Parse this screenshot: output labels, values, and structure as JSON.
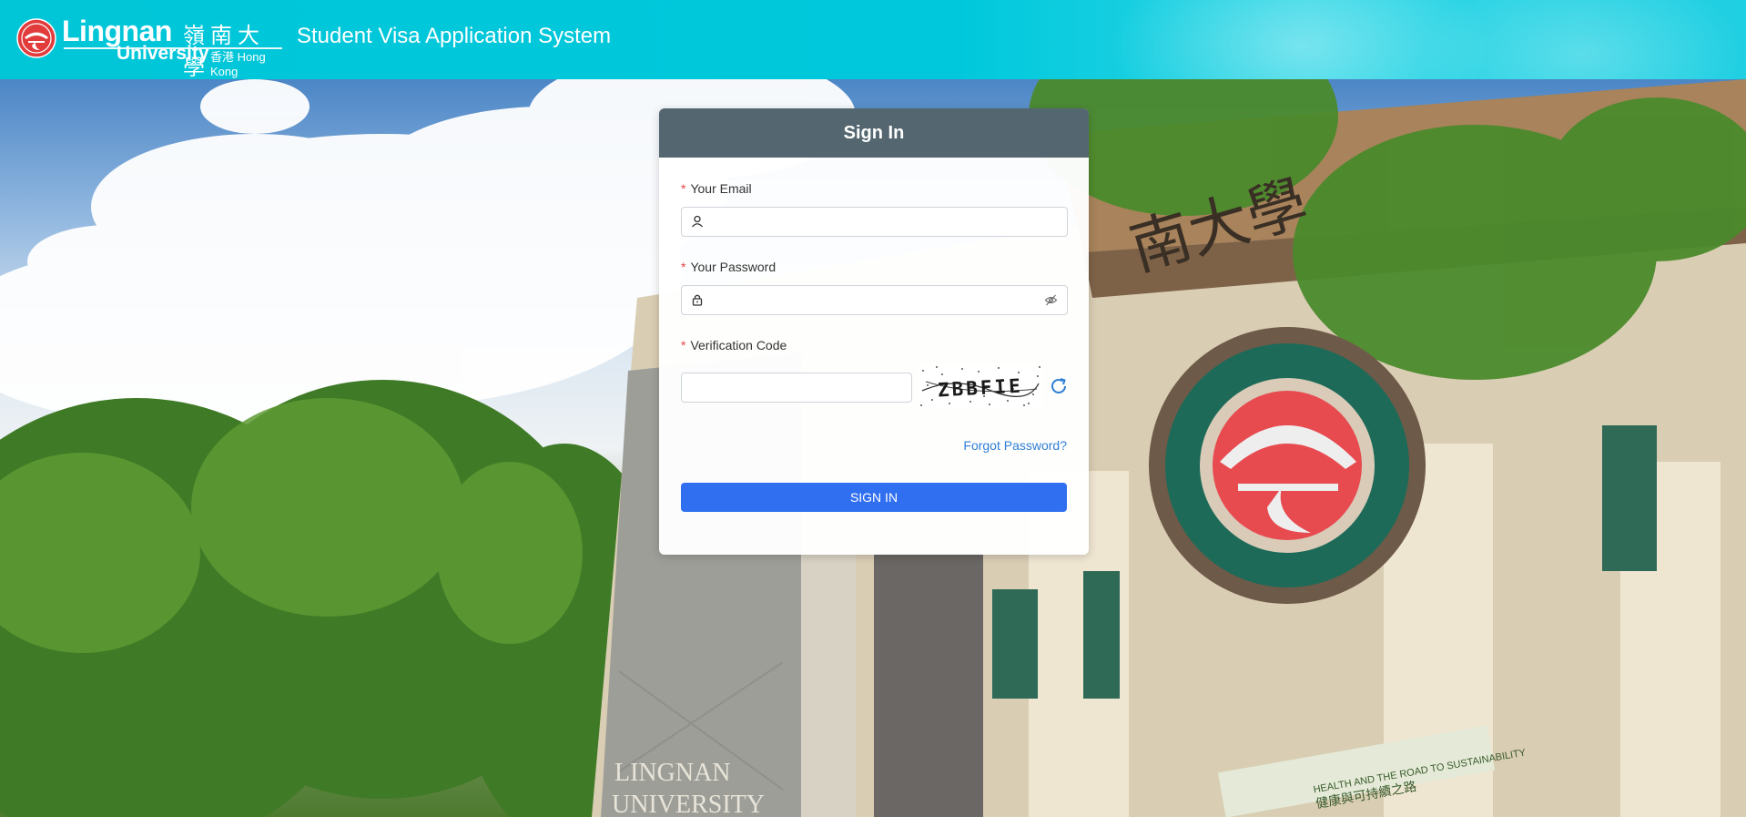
{
  "header": {
    "logo": {
      "name_en": "Lingnan",
      "name_zh": "嶺南大學",
      "university": "University",
      "location": "香港 Hong Kong",
      "seal_icon": "lingnan-seal-icon"
    },
    "app_title": "Student Visa Application System",
    "background_color": "#00c6d8"
  },
  "signin": {
    "title": "Sign In",
    "email": {
      "label": "Your Email",
      "required_mark": "*",
      "value": "",
      "icon": "user-icon"
    },
    "password": {
      "label": "Your Password",
      "required_mark": "*",
      "value": "",
      "icon": "lock-icon",
      "toggle_icon": "eye-off-icon"
    },
    "verification": {
      "label": "Verification Code",
      "required_mark": "*",
      "value": "",
      "captcha_text": "ZBBFIE",
      "refresh_icon": "refresh-icon"
    },
    "forgot_password": "Forgot Password?",
    "submit_label": "SIGN IN",
    "colors": {
      "header": "#546770",
      "button": "#2f6ff0",
      "link": "#2f7fd6",
      "required": "#e64545"
    }
  },
  "background": {
    "building_sign_zh": "南大學",
    "wall_sign_line1": "LINGNAN",
    "wall_sign_line2": "UNIVERSITY",
    "banner_line1": "HEALTH AND THE ROAD TO SUSTAINABILITY",
    "banner_line2": "健康與可持續之路"
  }
}
